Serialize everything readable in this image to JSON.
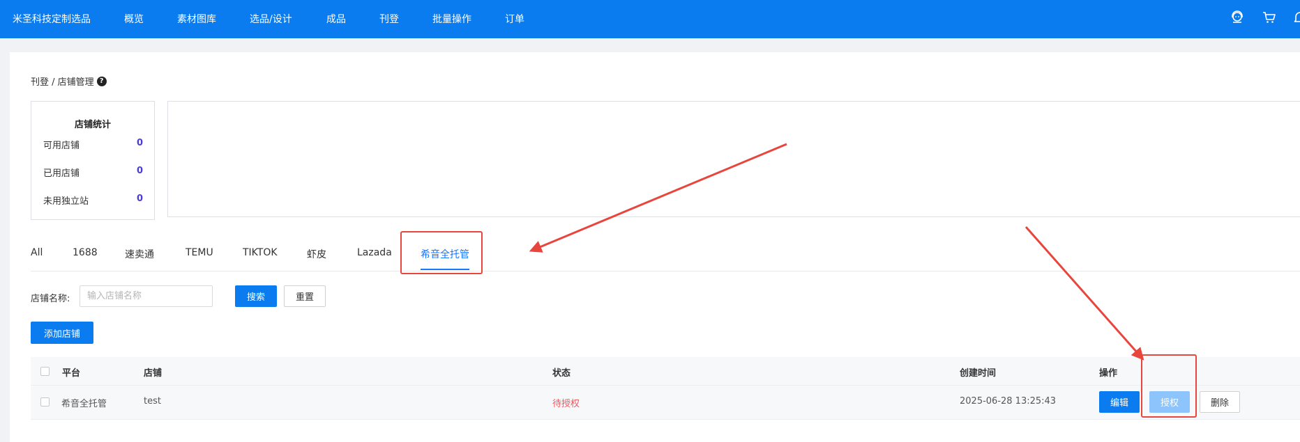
{
  "header": {
    "brand": "米圣科技定制选品",
    "menu": [
      "概览",
      "素材图库",
      "选品/设计",
      "成品",
      "刊登",
      "批量操作",
      "订单"
    ],
    "icons": [
      "user-support-icon",
      "cart-icon",
      "bell-icon"
    ]
  },
  "breadcrumb": {
    "text": "刊登 / 店铺管理"
  },
  "stats": {
    "title": "店铺统计",
    "rows": [
      {
        "label": "可用店铺",
        "value": "0"
      },
      {
        "label": "已用店铺",
        "value": "0"
      },
      {
        "label": "未用独立站",
        "value": "0"
      }
    ]
  },
  "tabs": {
    "items": [
      "All",
      "1688",
      "速卖通",
      "TEMU",
      "TIKTOK",
      "虾皮",
      "Lazada",
      "希音全托管"
    ],
    "active": "希音全托管"
  },
  "search": {
    "label": "店铺名称:",
    "placeholder": "输入店铺名称",
    "value": "",
    "search_button": "搜索",
    "reset_button": "重置"
  },
  "actions": {
    "add_shop": "添加店铺"
  },
  "table": {
    "columns": [
      "平台",
      "店铺",
      "状态",
      "创建时间",
      "操作"
    ],
    "rows": [
      {
        "platform": "希音全托管",
        "shop": "test",
        "status": "待授权",
        "created": "2025-06-28 13:25:43",
        "ops": [
          "编辑",
          "授权",
          "删除"
        ]
      }
    ]
  },
  "colors": {
    "primary": "#0a7cf0",
    "tab_active": "#1677ff",
    "status_pending": "#f0575c",
    "stat_value": "#4a3cd6",
    "annotation": "#e8453c"
  }
}
